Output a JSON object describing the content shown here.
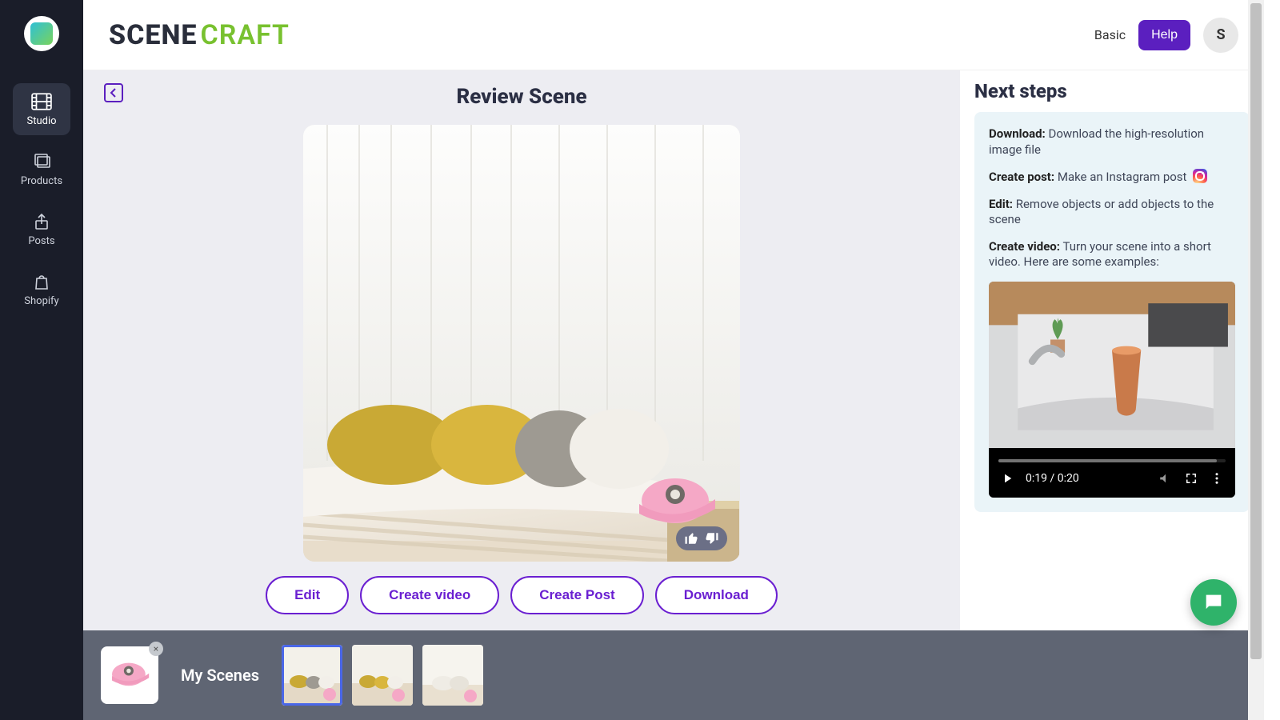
{
  "brand": {
    "a": "SCENE",
    "b": "CRAFT"
  },
  "top": {
    "plan": "Basic",
    "help": "Help",
    "avatar_initial": "S"
  },
  "sidebar": {
    "items": [
      {
        "label": "Studio"
      },
      {
        "label": "Products"
      },
      {
        "label": "Posts"
      },
      {
        "label": "Shopify"
      }
    ]
  },
  "review": {
    "title": "Review Scene",
    "actions": {
      "edit": "Edit",
      "create_video": "Create video",
      "create_post": "Create Post",
      "download": "Download"
    }
  },
  "next_steps": {
    "heading": "Next steps",
    "download_label": "Download:",
    "download_text": " Download the high-resolution image file",
    "create_post_label": "Create post:",
    "create_post_text": " Make an Instagram post ",
    "edit_label": "Edit:",
    "edit_text": " Remove objects or add objects to the scene",
    "create_video_label": "Create video:",
    "create_video_text": " Turn your scene into a short video. Here are some examples:",
    "video_time": "0:19 / 0:20"
  },
  "strip": {
    "label": "My Scenes"
  }
}
